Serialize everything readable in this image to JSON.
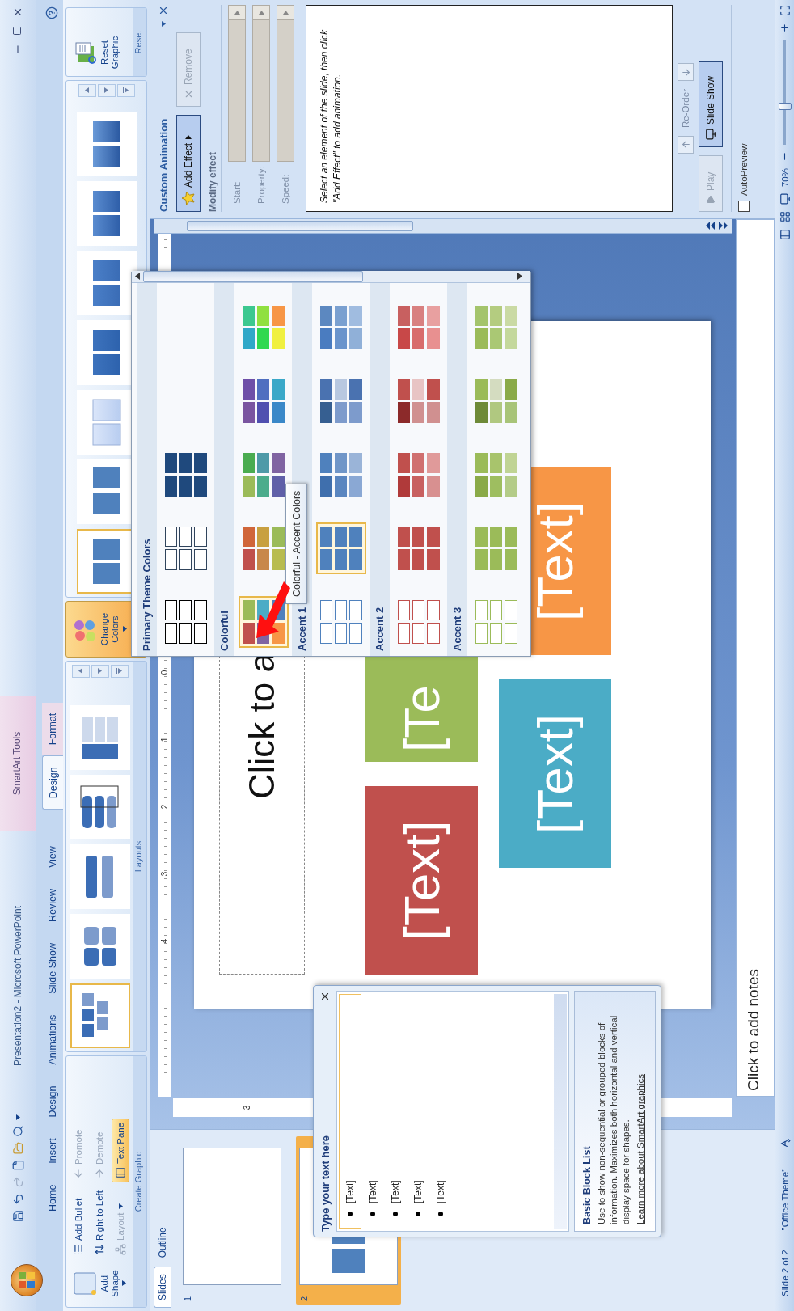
{
  "title_bar": {
    "title": "Presentation2 - Microsoft PowerPoint",
    "context_title": "SmartArt Tools"
  },
  "tabs": [
    {
      "label": "Home",
      "selected": false,
      "kind": "main"
    },
    {
      "label": "Insert",
      "selected": false,
      "kind": "main"
    },
    {
      "label": "Design",
      "selected": false,
      "kind": "main"
    },
    {
      "label": "Animations",
      "selected": false,
      "kind": "main"
    },
    {
      "label": "Slide Show",
      "selected": false,
      "kind": "main"
    },
    {
      "label": "Review",
      "selected": false,
      "kind": "main"
    },
    {
      "label": "View",
      "selected": false,
      "kind": "main"
    },
    {
      "label": "Design",
      "selected": true,
      "kind": "context"
    },
    {
      "label": "Format",
      "selected": false,
      "kind": "context"
    }
  ],
  "ribbon": {
    "create_graphic": {
      "label": "Create Graphic",
      "add_shape": "Add Shape",
      "items": [
        {
          "label": "Add Bullet",
          "kind": "button",
          "disabled": false,
          "on": false
        },
        {
          "label": "Right to Left",
          "kind": "button",
          "disabled": false,
          "on": false
        },
        {
          "label": "Layout",
          "kind": "dropdown",
          "disabled": true,
          "on": false
        },
        {
          "label": "Promote",
          "kind": "button",
          "disabled": true,
          "on": false
        },
        {
          "label": "Demote",
          "kind": "button",
          "disabled": true,
          "on": false
        },
        {
          "label": "Text Pane",
          "kind": "button",
          "disabled": false,
          "on": true
        }
      ]
    },
    "layouts": {
      "label": "Layouts",
      "items": [
        {
          "kind": "block-list",
          "selected": true
        },
        {
          "kind": "rounded-grid",
          "selected": false
        },
        {
          "kind": "bars",
          "selected": false
        },
        {
          "kind": "target-list",
          "selected": false
        },
        {
          "kind": "table-list",
          "selected": false
        }
      ]
    },
    "change_colors": {
      "label": "Change Colors",
      "open": true
    },
    "styles": {
      "items": [
        {
          "kind": "flat",
          "selected": true
        },
        {
          "kind": "gap",
          "selected": false
        },
        {
          "kind": "subtle",
          "selected": false
        },
        {
          "kind": "moderate",
          "selected": false
        },
        {
          "kind": "intense",
          "selected": false
        },
        {
          "kind": "bevel",
          "selected": false
        },
        {
          "kind": "raised",
          "selected": false
        }
      ]
    },
    "reset": {
      "button": "Reset Graphic",
      "label": "Reset"
    }
  },
  "slides_pane": {
    "tabs": [
      {
        "label": "Slides",
        "selected": true
      },
      {
        "label": "Outline",
        "selected": false
      }
    ],
    "thumbnails": [
      {
        "number": "1",
        "selected": false
      },
      {
        "number": "2",
        "selected": true
      }
    ]
  },
  "ruler": {
    "horizontal": [
      "4",
      "3",
      "2",
      "1",
      "0"
    ],
    "vertical": [
      "3"
    ]
  },
  "slide": {
    "title_placeholder": "Click to a",
    "blocks": [
      {
        "text": "[Text]",
        "color": "#c0504d"
      },
      {
        "text": "[Te",
        "color": "#9bbb59"
      },
      {
        "text": "[Text]",
        "color": "#4bacc6"
      },
      {
        "text": "[Text]",
        "color": "#f79646"
      }
    ]
  },
  "notes": {
    "placeholder": "Click to add notes"
  },
  "text_pane": {
    "title": "Type your text here",
    "bullets": [
      {
        "text": "[Text]",
        "selected": true
      },
      {
        "text": "[Text]",
        "selected": false
      },
      {
        "text": "[Text]",
        "selected": false
      },
      {
        "text": "[Text]",
        "selected": false
      },
      {
        "text": "[Text]",
        "selected": false
      }
    ],
    "layout_name": "Basic Block List",
    "description": "Use to show non-sequential or grouped blocks of information. Maximizes both horizontal and vertical display space for shapes.",
    "link": "Learn more about SmartArt graphics"
  },
  "colors_gallery": {
    "tooltip": "Colorful - Accent Colors",
    "sections": [
      {
        "title": "Primary Theme Colors",
        "swatches": [
          {
            "kind": "outline",
            "selected": false,
            "cells": [
              {
                "color": "#000000"
              },
              {
                "color": "#000000"
              },
              {
                "color": "#000000"
              },
              {
                "color": "#000000"
              },
              {
                "color": "#000000"
              },
              {
                "color": "#000000"
              }
            ]
          },
          {
            "kind": "outline",
            "selected": false,
            "cells": [
              {
                "color": "#30445c"
              },
              {
                "color": "#30445c"
              },
              {
                "color": "#30445c"
              },
              {
                "color": "#30445c"
              },
              {
                "color": "#30445c"
              },
              {
                "color": "#30445c"
              }
            ]
          },
          {
            "kind": "filled",
            "selected": false,
            "cells": [
              {
                "color": "#1f497d"
              },
              {
                "color": "#1f497d"
              },
              {
                "color": "#1f497d"
              },
              {
                "color": "#1f497d"
              },
              {
                "color": "#1f497d"
              },
              {
                "color": "#1f497d"
              }
            ]
          }
        ]
      },
      {
        "title": "Colorful",
        "swatches": [
          {
            "kind": "filled",
            "selected": true,
            "cells": [
              {
                "color": "#c0504d"
              },
              {
                "color": "#9bbb59"
              },
              {
                "color": "#8064a2"
              },
              {
                "color": "#4bacc6"
              },
              {
                "color": "#f79646"
              },
              {
                "color": "#4f81bd"
              }
            ]
          },
          {
            "kind": "filled",
            "selected": false,
            "cells": [
              {
                "color": "#c0504d"
              },
              {
                "color": "#d0663a"
              },
              {
                "color": "#c8874a"
              },
              {
                "color": "#c8a040"
              },
              {
                "color": "#b8bc50"
              },
              {
                "color": "#9bbb59"
              }
            ]
          },
          {
            "kind": "filled",
            "selected": false,
            "cells": [
              {
                "color": "#9bbb59"
              },
              {
                "color": "#4aac50"
              },
              {
                "color": "#4bac8c"
              },
              {
                "color": "#4e9aa8"
              },
              {
                "color": "#6060a8"
              },
              {
                "color": "#8064a2"
              }
            ]
          },
          {
            "kind": "filled",
            "selected": false,
            "cells": [
              {
                "color": "#7a55a0"
              },
              {
                "color": "#6e4fa8"
              },
              {
                "color": "#5050b0"
              },
              {
                "color": "#4f6fc0"
              },
              {
                "color": "#3a88c8"
              },
              {
                "color": "#3aa8c8"
              }
            ]
          },
          {
            "kind": "filled",
            "selected": false,
            "cells": [
              {
                "color": "#30a8c8"
              },
              {
                "color": "#3cc890"
              },
              {
                "color": "#30d850"
              },
              {
                "color": "#90e040"
              },
              {
                "color": "#f0f040"
              },
              {
                "color": "#f79646"
              }
            ]
          }
        ]
      },
      {
        "title": "Accent 1",
        "swatches": [
          {
            "kind": "outline",
            "selected": false,
            "cells": [
              {
                "color": "#4f81bd"
              },
              {
                "color": "#4f81bd"
              },
              {
                "color": "#4f81bd"
              },
              {
                "color": "#4f81bd"
              },
              {
                "color": "#4f81bd"
              },
              {
                "color": "#4f81bd"
              }
            ]
          },
          {
            "kind": "filled",
            "selected": true,
            "cells": [
              {
                "color": "#4f81bd"
              },
              {
                "color": "#4f81bd"
              },
              {
                "color": "#4f81bd"
              },
              {
                "color": "#4f81bd"
              },
              {
                "color": "#4f81bd"
              },
              {
                "color": "#4f81bd"
              }
            ]
          },
          {
            "kind": "filled",
            "selected": false,
            "cells": [
              {
                "color": "#3f6fad"
              },
              {
                "color": "#4f81bd"
              },
              {
                "color": "#5a86c0"
              },
              {
                "color": "#7096c8"
              },
              {
                "color": "#8aa8d4"
              },
              {
                "color": "#9ab4d8"
              }
            ]
          },
          {
            "kind": "filled",
            "selected": false,
            "cells": [
              {
                "color": "#365f91"
              },
              {
                "color": "#4a72b0"
              },
              {
                "color": "#7d9bcc"
              },
              {
                "color": "#b8c8e0"
              },
              {
                "color": "#7d9bcc"
              },
              {
                "color": "#4a72b0"
              }
            ]
          },
          {
            "kind": "filled",
            "selected": false,
            "cells": [
              {
                "color": "#4a7cc0"
              },
              {
                "color": "#5c88c0"
              },
              {
                "color": "#6a94cc"
              },
              {
                "color": "#7aa0d0"
              },
              {
                "color": "#90b0d8"
              },
              {
                "color": "#a0bce0"
              }
            ]
          }
        ]
      },
      {
        "title": "Accent 2",
        "swatches": [
          {
            "kind": "outline",
            "selected": false,
            "cells": [
              {
                "color": "#c0504d"
              },
              {
                "color": "#c0504d"
              },
              {
                "color": "#c0504d"
              },
              {
                "color": "#c0504d"
              },
              {
                "color": "#c0504d"
              },
              {
                "color": "#c0504d"
              }
            ]
          },
          {
            "kind": "filled",
            "selected": false,
            "cells": [
              {
                "color": "#c0504d"
              },
              {
                "color": "#c0504d"
              },
              {
                "color": "#c0504d"
              },
              {
                "color": "#c0504d"
              },
              {
                "color": "#c0504d"
              },
              {
                "color": "#c0504d"
              }
            ]
          },
          {
            "kind": "filled",
            "selected": false,
            "cells": [
              {
                "color": "#b03a3a"
              },
              {
                "color": "#c0504d"
              },
              {
                "color": "#c86060"
              },
              {
                "color": "#d07070"
              },
              {
                "color": "#d89090"
              },
              {
                "color": "#e09a9a"
              }
            ]
          },
          {
            "kind": "filled",
            "selected": false,
            "cells": [
              {
                "color": "#8c2a2a"
              },
              {
                "color": "#c0504d"
              },
              {
                "color": "#d09090"
              },
              {
                "color": "#e8c4c4"
              },
              {
                "color": "#d09090"
              },
              {
                "color": "#c0504d"
              }
            ]
          },
          {
            "kind": "filled",
            "selected": false,
            "cells": [
              {
                "color": "#c84848"
              },
              {
                "color": "#c86060"
              },
              {
                "color": "#d86c6c"
              },
              {
                "color": "#d88080"
              },
              {
                "color": "#e89090"
              },
              {
                "color": "#e8a0a0"
              }
            ]
          }
        ]
      },
      {
        "title": "Accent 3",
        "swatches": [
          {
            "kind": "outline",
            "selected": false,
            "cells": [
              {
                "color": "#9bbb59"
              },
              {
                "color": "#9bbb59"
              },
              {
                "color": "#9bbb59"
              },
              {
                "color": "#9bbb59"
              },
              {
                "color": "#9bbb59"
              },
              {
                "color": "#9bbb59"
              }
            ]
          },
          {
            "kind": "filled",
            "selected": false,
            "cells": [
              {
                "color": "#9bbb59"
              },
              {
                "color": "#9bbb59"
              },
              {
                "color": "#9bbb59"
              },
              {
                "color": "#9bbb59"
              },
              {
                "color": "#9bbb59"
              },
              {
                "color": "#9bbb59"
              }
            ]
          },
          {
            "kind": "filled",
            "selected": false,
            "cells": [
              {
                "color": "#8aaa48"
              },
              {
                "color": "#9bbb59"
              },
              {
                "color": "#9ebe60"
              },
              {
                "color": "#a8c46c"
              },
              {
                "color": "#b4cc88"
              },
              {
                "color": "#c0d494"
              }
            ]
          },
          {
            "kind": "filled",
            "selected": false,
            "cells": [
              {
                "color": "#6e8a38"
              },
              {
                "color": "#9bbb59"
              },
              {
                "color": "#b0c880"
              },
              {
                "color": "#d4dcc0"
              },
              {
                "color": "#a8c478"
              },
              {
                "color": "#8aaa48"
              }
            ]
          },
          {
            "kind": "filled",
            "selected": false,
            "cells": [
              {
                "color": "#9bbb59"
              },
              {
                "color": "#a4c46c"
              },
              {
                "color": "#aac874"
              },
              {
                "color": "#b4cc80"
              },
              {
                "color": "#c4d89c"
              },
              {
                "color": "#cadaa4"
              }
            ]
          }
        ]
      }
    ]
  },
  "animation_pane": {
    "title": "Custom Animation",
    "add_effect": {
      "label": "Add Effect",
      "disabled": false
    },
    "remove": {
      "label": "Remove",
      "disabled": true
    },
    "modify_label": "Modify effect",
    "fields": [
      {
        "label": "Start:",
        "disabled": true
      },
      {
        "label": "Property:",
        "disabled": true
      },
      {
        "label": "Speed:",
        "disabled": true
      }
    ],
    "hint": "Select an element of the slide, then click \"Add Effect\" to add animation.",
    "reorder": "Re-Order",
    "play": {
      "label": "Play",
      "disabled": true
    },
    "slide_show": {
      "label": "Slide Show",
      "disabled": false
    },
    "autopreview": {
      "label": "AutoPreview",
      "checked": false
    }
  },
  "status_bar": {
    "slide": "Slide 2 of 2",
    "theme": "\"Office Theme\"",
    "zoom": "70%",
    "zoom_slider": {
      "level": 0.36
    }
  }
}
